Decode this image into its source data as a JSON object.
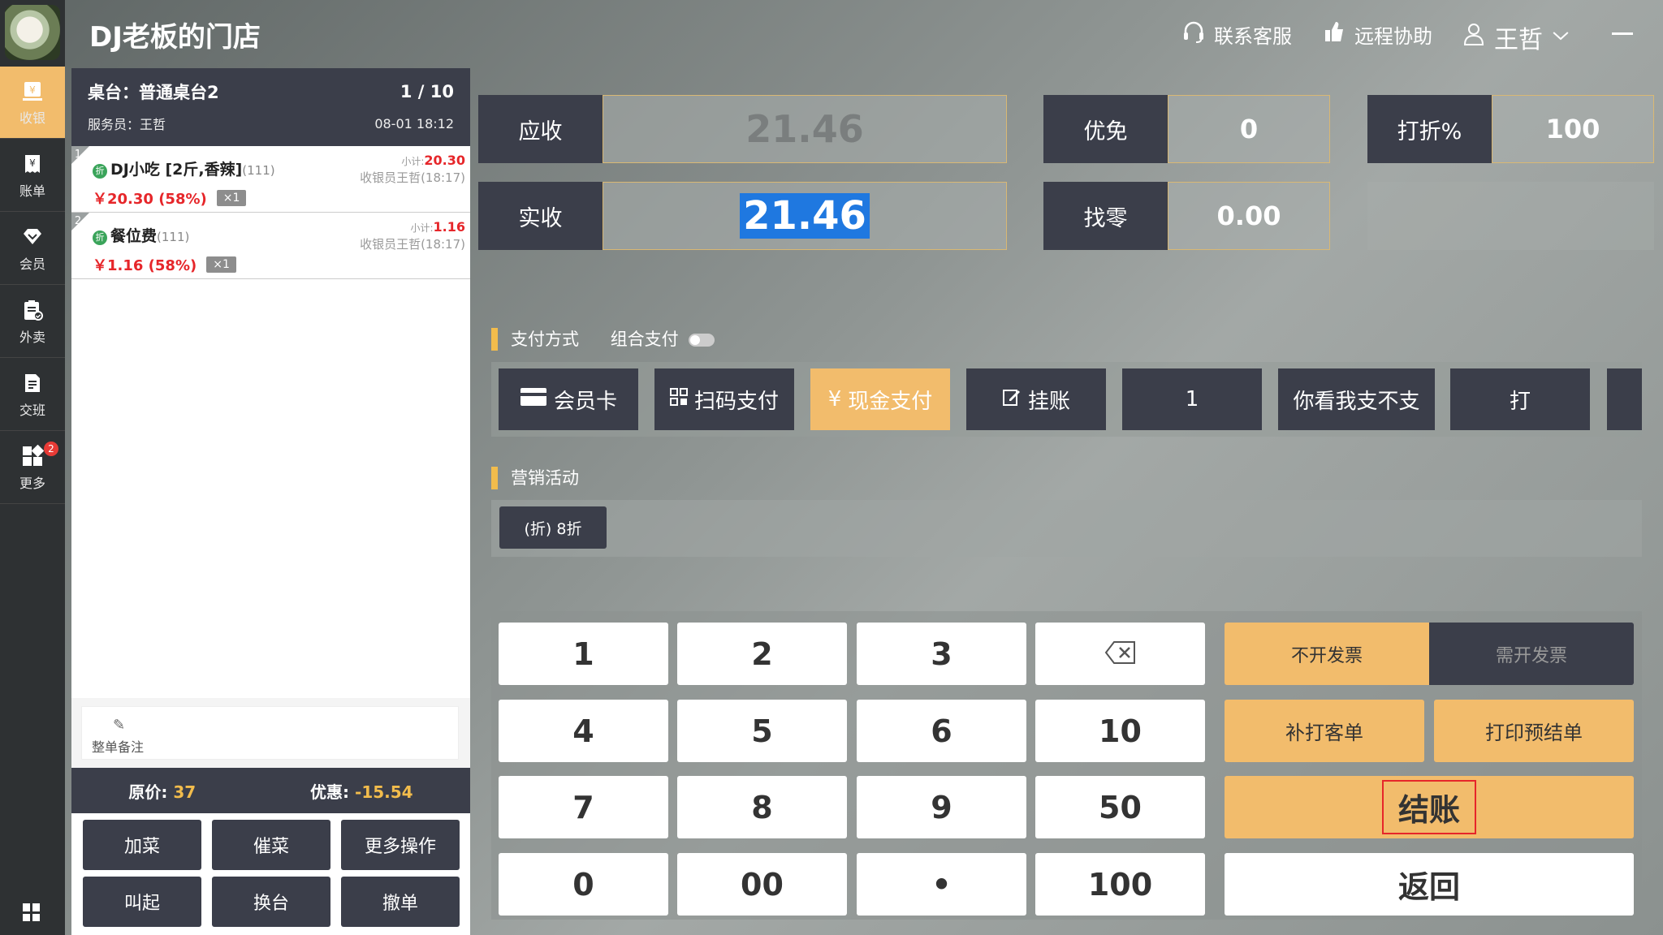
{
  "header": {
    "store_name": "DJ老板的门店",
    "support": "联系客服",
    "remote": "远程协助",
    "user": "王哲"
  },
  "sidebar": {
    "items": [
      {
        "label": "收银",
        "icon": "cashier-icon"
      },
      {
        "label": "账单",
        "icon": "bill-icon"
      },
      {
        "label": "会员",
        "icon": "member-icon"
      },
      {
        "label": "外卖",
        "icon": "takeout-icon"
      },
      {
        "label": "交班",
        "icon": "shift-icon"
      },
      {
        "label": "更多",
        "icon": "more-icon"
      }
    ],
    "more_badge": "2"
  },
  "order": {
    "table": "桌台：普通桌台2",
    "page": "1 / 10",
    "waiter": "服务员：王哲",
    "datetime": "08-01 18:12",
    "items": [
      {
        "no": "1",
        "tag": "折",
        "name": "DJ小吃 [2斤,香辣]",
        "code": "(111)",
        "price": "￥20.30 (58%)",
        "qty": "×1",
        "subtotal_label": "小计:",
        "subtotal": "20.30",
        "cashier": "收银员王哲(18:17)"
      },
      {
        "no": "2",
        "tag": "折",
        "name": "餐位费",
        "code": "(111)",
        "price": "￥1.16 (58%)",
        "qty": "×1",
        "subtotal_label": "小计:",
        "subtotal": "1.16",
        "cashier": "收银员王哲(18:17)"
      }
    ],
    "note_label": "整单备注",
    "original_label": "原价:",
    "original": "37",
    "discount_label": "优惠:",
    "discount": "-15.54",
    "actions": [
      "加菜",
      "催菜",
      "更多操作",
      "叫起",
      "换台",
      "撤单"
    ]
  },
  "payment": {
    "receivable_label": "应收",
    "receivable": "21.46",
    "actual_label": "实收",
    "actual": "21.46",
    "free_label": "优免",
    "free": "0",
    "change_label": "找零",
    "change": "0.00",
    "discount_pct_label": "打折%",
    "discount_pct": "100"
  },
  "pay_method": {
    "title": "支付方式",
    "combo_label": "组合支付",
    "options": [
      "会员卡",
      "扫码支付",
      "现金支付",
      "挂账",
      "1",
      "你看我支不支",
      "打"
    ],
    "selected": "现金支付"
  },
  "promotion": {
    "title": "营销活动",
    "items": [
      "(折) 8折"
    ]
  },
  "keypad": {
    "keys": [
      "1",
      "2",
      "3",
      "⌫",
      "4",
      "5",
      "6",
      "10",
      "7",
      "8",
      "9",
      "50",
      "0",
      "00",
      "•",
      "100"
    ]
  },
  "invoice": {
    "no": "不开发票",
    "yes": "需开发票"
  },
  "actions": {
    "reprint": "补打客单",
    "preprint": "打印预结单",
    "checkout": "结账",
    "back": "返回"
  },
  "colors": {
    "accent": "#f2bc6c",
    "dark": "#3b3e4a",
    "red": "#e6262a",
    "selected_text": "#1f78e0"
  }
}
